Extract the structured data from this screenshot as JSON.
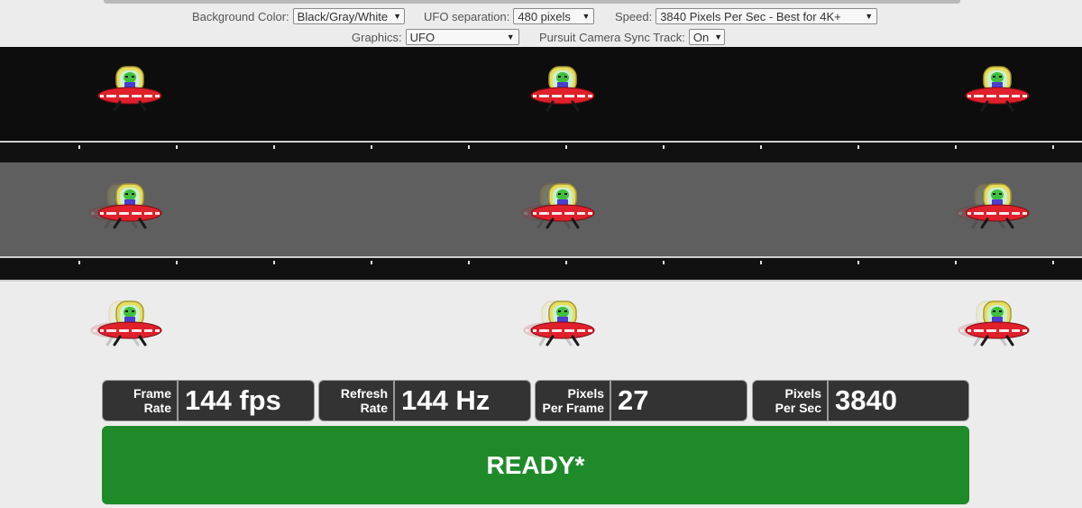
{
  "controls": {
    "background_color": {
      "label": "Background Color:",
      "value": "Black/Gray/White"
    },
    "ufo_separation": {
      "label": "UFO separation:",
      "value": "480 pixels"
    },
    "speed": {
      "label": "Speed:",
      "value": "3840 Pixels Per Sec - Best for 4K+"
    },
    "graphics": {
      "label": "Graphics:",
      "value": "UFO"
    },
    "pursuit_camera": {
      "label": "Pursuit Camera Sync Track:",
      "value": "On"
    }
  },
  "stats": [
    {
      "label_line1": "Frame",
      "label_line2": "Rate",
      "value": "144 fps"
    },
    {
      "label_line1": "Refresh",
      "label_line2": "Rate",
      "value": "144 Hz"
    },
    {
      "label_line1": "Pixels",
      "label_line2": "Per Frame",
      "value": "27"
    },
    {
      "label_line1": "Pixels",
      "label_line2": "Per Sec",
      "value": "3840"
    }
  ],
  "status": {
    "text": "READY*"
  },
  "colors": {
    "ready_green": "#1f8a2a",
    "ufo_red": "#e0202a",
    "alien_green": "#3fbf3f",
    "dome_yellow": "#e8d85a"
  },
  "icons": {
    "ufo": "ufo-alien-icon"
  }
}
